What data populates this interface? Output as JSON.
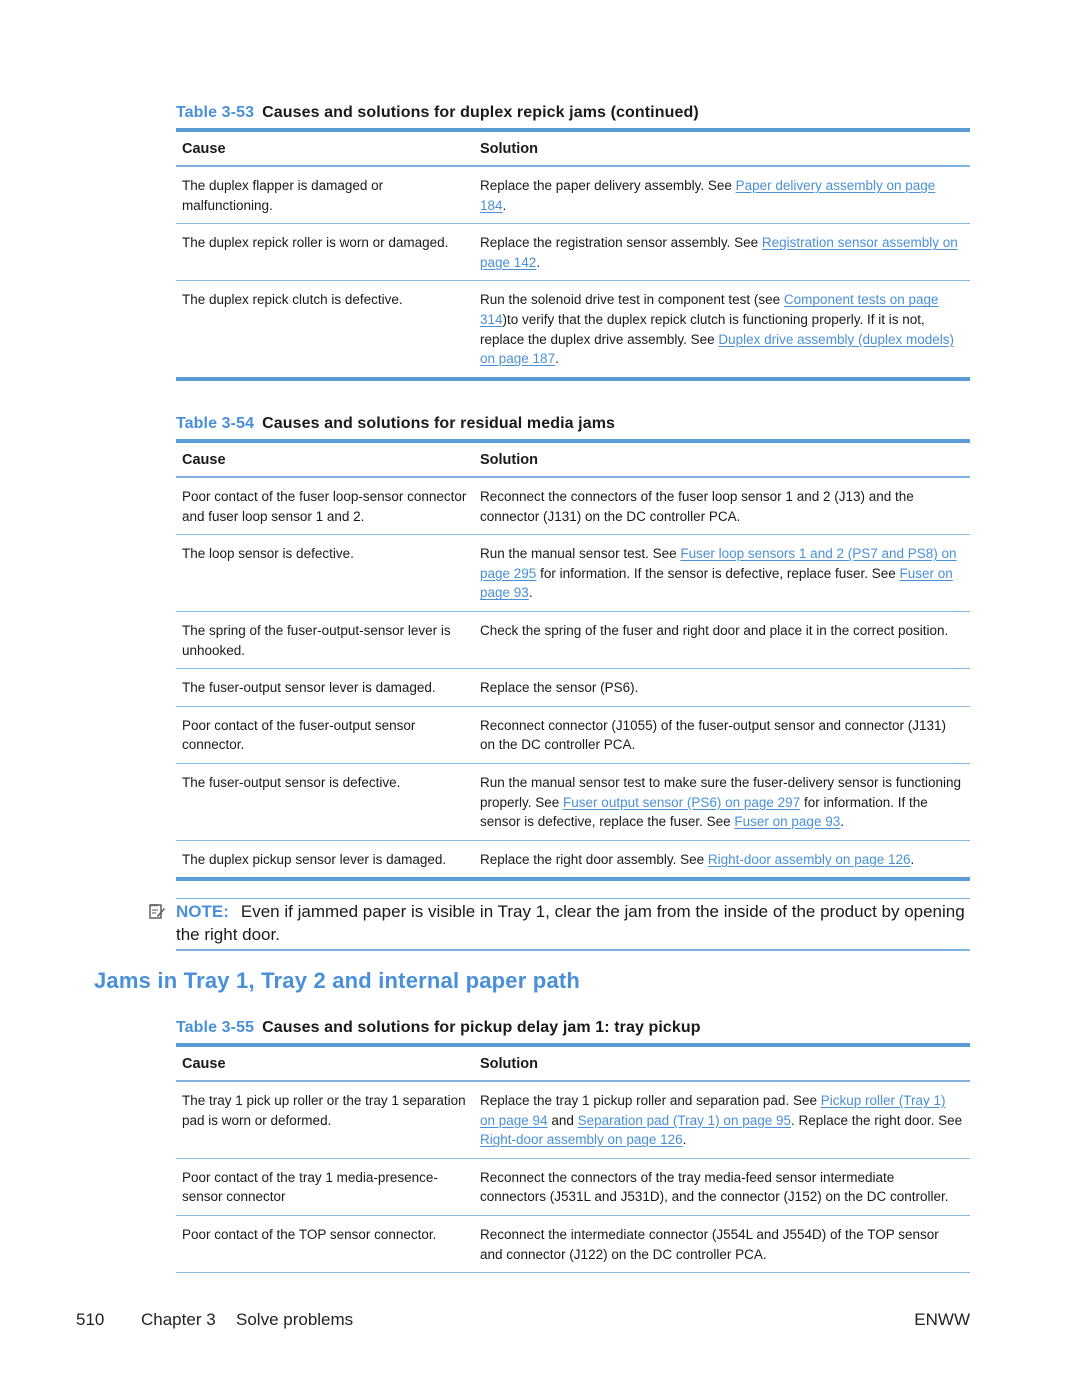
{
  "colors": {
    "accent": "#4a90d9",
    "rule": "#5b9bd5"
  },
  "tables": [
    {
      "number": "Table 3-53",
      "title": "Causes and solutions for duplex repick jams (continued)",
      "headers": [
        "Cause",
        "Solution"
      ],
      "rows": [
        {
          "cause": "The duplex flapper is damaged or malfunctioning.",
          "solution": [
            {
              "t": "Replace the paper delivery assembly. See "
            },
            {
              "t": "Paper delivery assembly on page 184",
              "link": true
            },
            {
              "t": "."
            }
          ]
        },
        {
          "cause": "The duplex repick roller is worn or damaged.",
          "solution": [
            {
              "t": "Replace the registration sensor assembly. See "
            },
            {
              "t": "Registration sensor assembly on page 142",
              "link": true
            },
            {
              "t": "."
            }
          ]
        },
        {
          "cause": "The duplex repick clutch is defective.",
          "solution": [
            {
              "t": "Run the solenoid drive test in component test (see "
            },
            {
              "t": "Component tests on page 314",
              "link": true
            },
            {
              "t": ")to verify that the duplex repick clutch is functioning properly. If it is not, replace the duplex drive assembly. See "
            },
            {
              "t": "Duplex drive assembly (duplex models) on page 187",
              "link": true
            },
            {
              "t": "."
            }
          ]
        }
      ]
    },
    {
      "number": "Table 3-54",
      "title": "Causes and solutions for residual media jams",
      "headers": [
        "Cause",
        "Solution"
      ],
      "rows": [
        {
          "cause": "Poor contact of the fuser loop-sensor connector and fuser loop sensor 1 and 2.",
          "solution": [
            {
              "t": "Reconnect the connectors of the fuser loop sensor 1 and 2 (J13) and the connector (J131) on the DC controller PCA."
            }
          ]
        },
        {
          "cause": "The loop sensor is defective.",
          "solution": [
            {
              "t": "Run the manual sensor test. See "
            },
            {
              "t": "Fuser loop sensors 1 and 2 (PS7 and PS8) on page 295",
              "link": true
            },
            {
              "t": " for information. If the sensor is defective, replace fuser. See "
            },
            {
              "t": "Fuser on page 93",
              "link": true
            },
            {
              "t": "."
            }
          ]
        },
        {
          "cause": "The spring of the fuser-output-sensor lever is unhooked.",
          "solution": [
            {
              "t": "Check the spring of the fuser and right door and place it in the correct position."
            }
          ]
        },
        {
          "cause": "The fuser-output sensor lever is damaged.",
          "solution": [
            {
              "t": "Replace the sensor (PS6)."
            }
          ]
        },
        {
          "cause": "Poor contact of the fuser-output sensor connector.",
          "solution": [
            {
              "t": "Reconnect connector (J1055) of the fuser-output sensor and connector (J131) on the DC controller PCA."
            }
          ]
        },
        {
          "cause": "The fuser-output sensor is defective.",
          "solution": [
            {
              "t": "Run the manual sensor test to make sure the fuser-delivery sensor is functioning properly. See "
            },
            {
              "t": "Fuser output sensor (PS6) on page 297",
              "link": true
            },
            {
              "t": " for information. If the sensor is defective, replace the fuser. See "
            },
            {
              "t": "Fuser on page 93",
              "link": true
            },
            {
              "t": "."
            }
          ]
        },
        {
          "cause": "The duplex pickup sensor lever is damaged.",
          "solution": [
            {
              "t": "Replace the right door assembly. See "
            },
            {
              "t": "Right-door assembly on page 126",
              "link": true
            },
            {
              "t": "."
            }
          ]
        }
      ]
    },
    {
      "number": "Table 3-55",
      "title": "Causes and solutions for pickup delay jam 1: tray pickup",
      "headers": [
        "Cause",
        "Solution"
      ],
      "rows": [
        {
          "cause": "The tray 1 pick up roller or the tray 1 separation pad is worn or deformed.",
          "solution": [
            {
              "t": "Replace the tray 1 pickup roller and separation pad. See "
            },
            {
              "t": "Pickup roller (Tray 1) on page 94",
              "link": true
            },
            {
              "t": " and "
            },
            {
              "t": "Separation pad (Tray 1) on page 95",
              "link": true
            },
            {
              "t": ". Replace the right door. See "
            },
            {
              "t": "Right-door assembly on page 126",
              "link": true
            },
            {
              "t": "."
            }
          ]
        },
        {
          "cause": "Poor contact of the tray 1 media-presence-sensor connector",
          "solution": [
            {
              "t": "Reconnect the connectors of the tray media-feed sensor intermediate connectors (J531L and J531D), and the connector (J152) on the DC controller."
            }
          ]
        },
        {
          "cause": "Poor contact of the TOP sensor connector.",
          "solution": [
            {
              "t": "Reconnect the intermediate connector (J554L and J554D) of the TOP sensor and connector (J122) on the DC controller PCA."
            }
          ]
        }
      ]
    }
  ],
  "note": {
    "icon": "note-pencil-icon",
    "label": "NOTE:",
    "text": "Even if jammed paper is visible in Tray 1, clear the jam from the inside of the product by opening the right door."
  },
  "section": {
    "title": "Jams in Tray 1, Tray 2 and internal paper path"
  },
  "footer": {
    "page": "510",
    "chapter": "Chapter 3",
    "chapter_title": "Solve problems",
    "locale": "ENWW"
  }
}
